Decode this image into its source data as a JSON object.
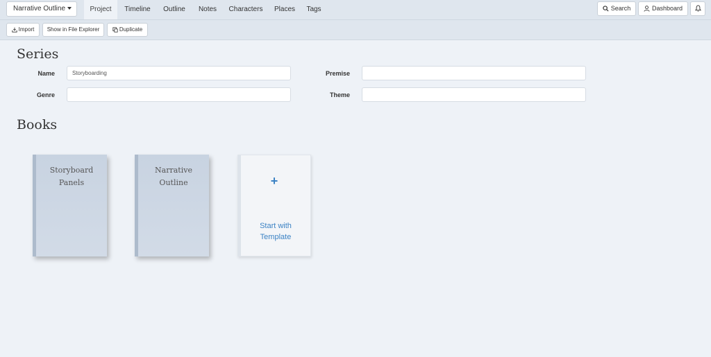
{
  "nav": {
    "project_dropdown": "Narrative Outline",
    "tabs": [
      {
        "label": "Project",
        "active": true
      },
      {
        "label": "Timeline"
      },
      {
        "label": "Outline"
      },
      {
        "label": "Notes"
      },
      {
        "label": "Characters"
      },
      {
        "label": "Places"
      },
      {
        "label": "Tags"
      }
    ],
    "search_label": "Search",
    "dashboard_label": "Dashboard"
  },
  "toolbar": {
    "import_label": "Import",
    "show_in_explorer_label": "Show in File Explorer",
    "duplicate_label": "Duplicate"
  },
  "series": {
    "heading": "Series",
    "name_label": "Name",
    "name_value": "Storyboarding",
    "genre_label": "Genre",
    "genre_value": "",
    "premise_label": "Premise",
    "premise_value": "",
    "theme_label": "Theme",
    "theme_value": ""
  },
  "books": {
    "heading": "Books",
    "items": [
      {
        "title_line1": "Storyboard",
        "title_line2": "Panels"
      },
      {
        "title_line1": "Narrative",
        "title_line2": "Outline"
      }
    ],
    "template_plus": "+",
    "template_line1": "Start with",
    "template_line2": "Template"
  },
  "colors": {
    "accent": "#3b82c4",
    "book_cover": "#c8d3e1",
    "nav_bg": "#dfe6ee",
    "page_bg": "#eef2f7"
  },
  "icons": [
    "import-icon",
    "duplicate-icon",
    "search-icon",
    "user-icon",
    "bell-icon",
    "caret-down-icon",
    "plus-icon"
  ]
}
